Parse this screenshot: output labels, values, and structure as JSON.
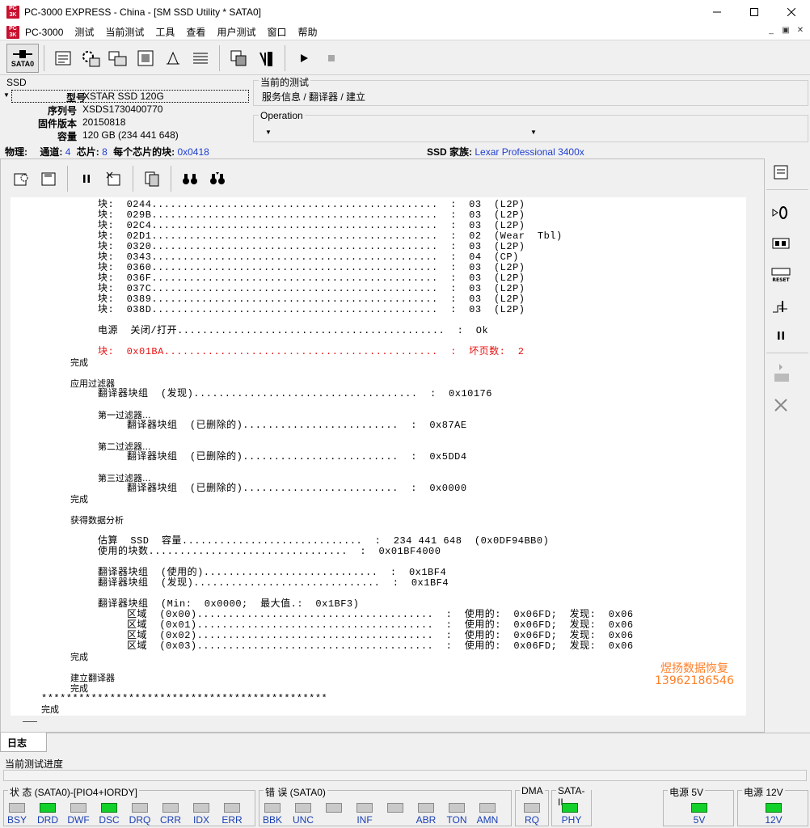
{
  "window": {
    "title": "PC-3000 EXPRESS - China - [SM SSD Utility * SATA0]",
    "logo_text": "PC 3000"
  },
  "menu": [
    "PC-3000",
    "测试",
    "当前测试",
    "工具",
    "查看",
    "用户测试",
    "窗口",
    "帮助"
  ],
  "toolbar": {
    "sata_label": "SATA0"
  },
  "ssd": {
    "group_title": "SSD",
    "model_label": "型号",
    "model": "XSTAR SSD 120G",
    "serial_label": "序列号",
    "serial": "XSDS1730400770",
    "firmware_label": "固件版本",
    "firmware": "20150818",
    "capacity_label": "容量",
    "capacity": "120 GB (234 441 648)"
  },
  "current_test": {
    "title": "当前的测试",
    "value": "服务信息 / 翻译器 / 建立"
  },
  "operation": {
    "title": "Operation"
  },
  "physical": {
    "label": "物理:",
    "channels_label": "通道:",
    "channels": "4",
    "chips_label": "芯片:",
    "chips": "8",
    "blocks_per_chip_label": "每个芯片的块:",
    "blocks_per_chip": "0x0418",
    "family_label": "SSD 家族:",
    "family": "Lexar Professional 3400x"
  },
  "log": {
    "lines": [
      "块:  0244..............................................  :  03  (L2P)",
      "块:  029B..............................................  :  03  (L2P)",
      "块:  02C4..............................................  :  03  (L2P)",
      "块:  02D1..............................................  :  02  (Wear  Tbl)",
      "块:  0320..............................................  :  03  (L2P)",
      "块:  0343..............................................  :  04  (CP)",
      "块:  0360..............................................  :  03  (L2P)",
      "块:  036F..............................................  :  03  (L2P)",
      "块:  037C..............................................  :  03  (L2P)",
      "块:  0389..............................................  :  03  (L2P)",
      "块:  038D..............................................  :  03  (L2P)",
      "电源  关闭/打开...........................................  :  Ok",
      "块:  0x01BA............................................  :  坏页数:  2",
      "完成",
      "应用过滤器",
      "翻译器块组  (发现)....................................  :  0x10176",
      "第一过滤器...",
      "翻译器块组  (已删除的).........................  :  0x87AE",
      "第二过滤器...",
      "翻译器块组  (已删除的).........................  :  0x5DD4",
      "第三过滤器...",
      "翻译器块组  (已删除的).........................  :  0x0000",
      "完成",
      "获得数据分析",
      "估算  SSD  容量.............................  :  234 441 648  (0x0DF94BB0)",
      "使用的块数................................  :  0x01BF4000",
      "翻译器块组  (使用的)............................  :  0x1BF4",
      "翻译器块组  (发现)..............................  :  0x1BF4",
      "翻译器块组  (Min:  0x0000;  最大值.:  0x1BF3)",
      "区域  (0x00)......................................  :  使用的:  0x06FD;  发现:  0x06",
      "区域  (0x01)......................................  :  使用的:  0x06FD;  发现:  0x06",
      "区域  (0x02)......................................  :  使用的:  0x06FD;  发现:  0x06",
      "区域  (0x03)......................................  :  使用的:  0x06FD;  发现:  0x06",
      "完成",
      "建立翻译器",
      "完成",
      "**********************************************",
      "完成"
    ],
    "watermark_line1": "煜扬数据恢复",
    "watermark_line2": "13962186546"
  },
  "tab": {
    "log": "日志"
  },
  "progress": {
    "label": "当前测试进度",
    "value": 0
  },
  "status": {
    "state_title": "状 态 (SATA0)-[PIO4+IORDY]",
    "state_leds": [
      {
        "label": "BSY",
        "on": false
      },
      {
        "label": "DRD",
        "on": true
      },
      {
        "label": "DWF",
        "on": false
      },
      {
        "label": "DSC",
        "on": true
      },
      {
        "label": "DRQ",
        "on": false
      },
      {
        "label": "CRR",
        "on": false
      },
      {
        "label": "IDX",
        "on": false
      },
      {
        "label": "ERR",
        "on": false
      }
    ],
    "error_title": "错 误 (SATA0)",
    "error_leds": [
      {
        "label": "BBK",
        "on": false
      },
      {
        "label": "UNC",
        "on": false
      },
      {
        "label": "",
        "on": false
      },
      {
        "label": "INF",
        "on": false
      },
      {
        "label": "",
        "on": false
      },
      {
        "label": "ABR",
        "on": false
      },
      {
        "label": "TON",
        "on": false
      },
      {
        "label": "AMN",
        "on": false
      }
    ],
    "dma_title": "DMA",
    "dma_led": {
      "label": "RQ",
      "on": false
    },
    "sata_title": "SATA-II",
    "sata_led": {
      "label": "PHY",
      "on": true
    },
    "power5_title": "电源 5V",
    "power5_led": {
      "label": "5V",
      "on": true
    },
    "power12_title": "电源 12V",
    "power12_led": {
      "label": "12V",
      "on": true
    }
  },
  "colors": {
    "led_on": "#12d12a",
    "log_error": "#e81010",
    "link_blue": "#1f3fd0",
    "watermark": "#ff7f27"
  }
}
